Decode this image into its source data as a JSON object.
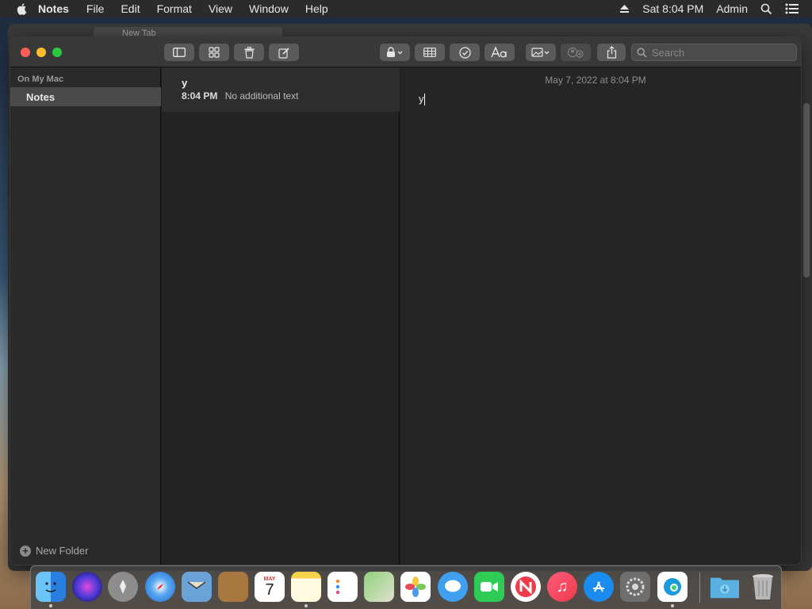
{
  "menubar": {
    "app_name": "Notes",
    "items": [
      "File",
      "Edit",
      "Format",
      "View",
      "Window",
      "Help"
    ],
    "clock": "Sat 8:04 PM",
    "user": "Admin"
  },
  "background_window": {
    "tab_title": "New Tab"
  },
  "toolbar": {
    "search_placeholder": "Search"
  },
  "sidebar": {
    "section_title": "On My Mac",
    "folders": [
      {
        "label": "Notes",
        "selected": true
      }
    ],
    "new_folder_label": "New Folder"
  },
  "note_list": {
    "items": [
      {
        "title": "y",
        "time": "8:04 PM",
        "preview": "No additional text",
        "selected": true
      }
    ]
  },
  "editor": {
    "date": "May 7, 2022 at 8:04 PM",
    "body": "y"
  },
  "dock": {
    "apps": [
      {
        "name": "finder-icon",
        "color": "#2d8cf0"
      },
      {
        "name": "siri-icon",
        "color": "#4a2a8a"
      },
      {
        "name": "launchpad-icon",
        "color": "#8a8a8a"
      },
      {
        "name": "safari-icon",
        "color": "#1e88e5"
      },
      {
        "name": "mail-icon",
        "color": "#6aa3d8"
      },
      {
        "name": "contacts-icon",
        "color": "#a07040"
      },
      {
        "name": "calendar-icon",
        "color": "#ffffff"
      },
      {
        "name": "notes-icon",
        "color": "#f6e27a"
      },
      {
        "name": "reminders-icon",
        "color": "#ffffff"
      },
      {
        "name": "maps-icon",
        "color": "#6cc070"
      },
      {
        "name": "photos-icon",
        "color": "#ffffff"
      },
      {
        "name": "messages-icon",
        "color": "#3fa0f0"
      },
      {
        "name": "facetime-icon",
        "color": "#2ecc55"
      },
      {
        "name": "news-icon",
        "color": "#f03a4a"
      },
      {
        "name": "music-icon",
        "color": "#f0506a"
      },
      {
        "name": "app-store-icon",
        "color": "#1a8cf0"
      },
      {
        "name": "system-preferences-icon",
        "color": "#7a7a7a"
      },
      {
        "name": "edge-icon",
        "color": "#1a9ad8"
      },
      {
        "name": "downloads-folder-icon",
        "color": "#5ab0e0"
      },
      {
        "name": "trash-icon",
        "color": "#9a9a9a"
      }
    ],
    "calendar_month": "MAY",
    "calendar_day": "7"
  }
}
